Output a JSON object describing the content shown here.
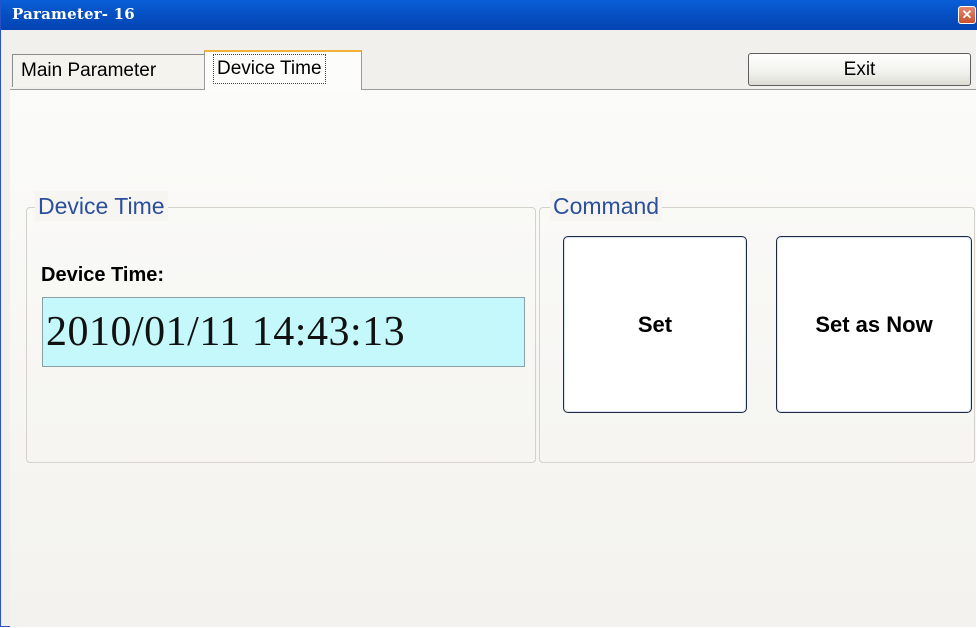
{
  "window": {
    "title": "Parameter- 16",
    "close_label": "✕"
  },
  "tabs": [
    {
      "label": "Main Parameter",
      "selected": false
    },
    {
      "label": "Device Time",
      "selected": true
    }
  ],
  "toolbar": {
    "exit_label": "Exit"
  },
  "device_time_group": {
    "legend": "Device Time",
    "field_label": "Device Time:",
    "value": "2010/01/11 14:43:13"
  },
  "command_group": {
    "legend": "Command",
    "set_label": "Set",
    "set_now_label": "Set as Now"
  },
  "colors": {
    "titlebar": "#0550c4",
    "time_field_bg": "#c4f8fa",
    "legend_text": "#2c4f9c",
    "selected_tab_accent": "#f2b23a"
  }
}
